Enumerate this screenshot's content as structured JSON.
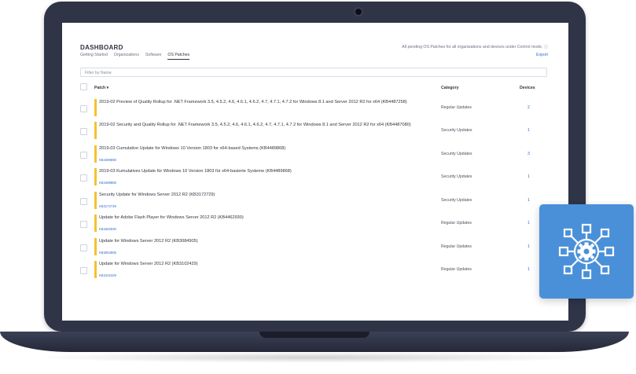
{
  "header": {
    "title": "DASHBOARD",
    "tabs": [
      {
        "label": "Getting Started"
      },
      {
        "label": "Organizations"
      },
      {
        "label": "Software"
      },
      {
        "label": "OS Patches"
      }
    ],
    "notice": "All pending OS Patches for all organizations and devices under Control mode. ⓘ",
    "export_label": "Export"
  },
  "filter": {
    "placeholder": "Filter by Name"
  },
  "table": {
    "columns": {
      "patch": "Patch ▾",
      "category": "Category",
      "devices": "Devices"
    },
    "rows": [
      {
        "title": "2019-02 Preview of Quality Rollup for .NET Framework 3.5, 4.5.2, 4.6, 4.6.1, 4.6.2, 4.7, 4.7.1, 4.7.2 for Windows 8.1 and Server 2012 R2 for x64 (KB4487258)",
        "kb": "",
        "category": "Regular Updates",
        "devices": "2"
      },
      {
        "title": "2019-02 Security and Quality Rollup for .NET Framework 3.5, 4.5.2, 4.6, 4.6.1, 4.6.2, 4.7, 4.7.1, 4.7.2 for Windows 8.1 and Server 2012 R2 for x64 (KB4487080)",
        "kb": "",
        "category": "Security Updates",
        "devices": "1"
      },
      {
        "title": "2019-03 Cumulative Update for Windows 10 Version 1803 for x64-based Systems (KB4489868)",
        "kb": "KB4489868",
        "category": "Security Updates",
        "devices": "3"
      },
      {
        "title": "2019-03 Kumulatives Update für Windows 10 Version 1803 für x64-basierte Systeme (KB4489868)",
        "kb": "KB4489868",
        "category": "Security Updates",
        "devices": "1"
      },
      {
        "title": "Security Update for Windows Server 2012 R2 (KB3172729)",
        "kb": "KB3172729",
        "category": "Security Updates",
        "devices": "1"
      },
      {
        "title": "Update for Adobe Flash Player for Windows Server 2012 R2 (KB4462930)",
        "kb": "KB4462930",
        "category": "Regular Updates",
        "devices": "1"
      },
      {
        "title": "Update for Windows Server 2012 R2 (KB3084905)",
        "kb": "KB3084905",
        "category": "Regular Updates",
        "devices": "1"
      },
      {
        "title": "Update for Windows Server 2012 R2 (KB3102429)",
        "kb": "KB3102429",
        "category": "Regular Updates",
        "devices": "1"
      }
    ]
  },
  "colors": {
    "accent": "#2f6fd0",
    "row_marker": "#f4c230",
    "tile": "#4a90d9",
    "laptop": "#2f3447"
  },
  "icons": {
    "tile": "network-gear-icon",
    "camera": "camera-icon"
  }
}
